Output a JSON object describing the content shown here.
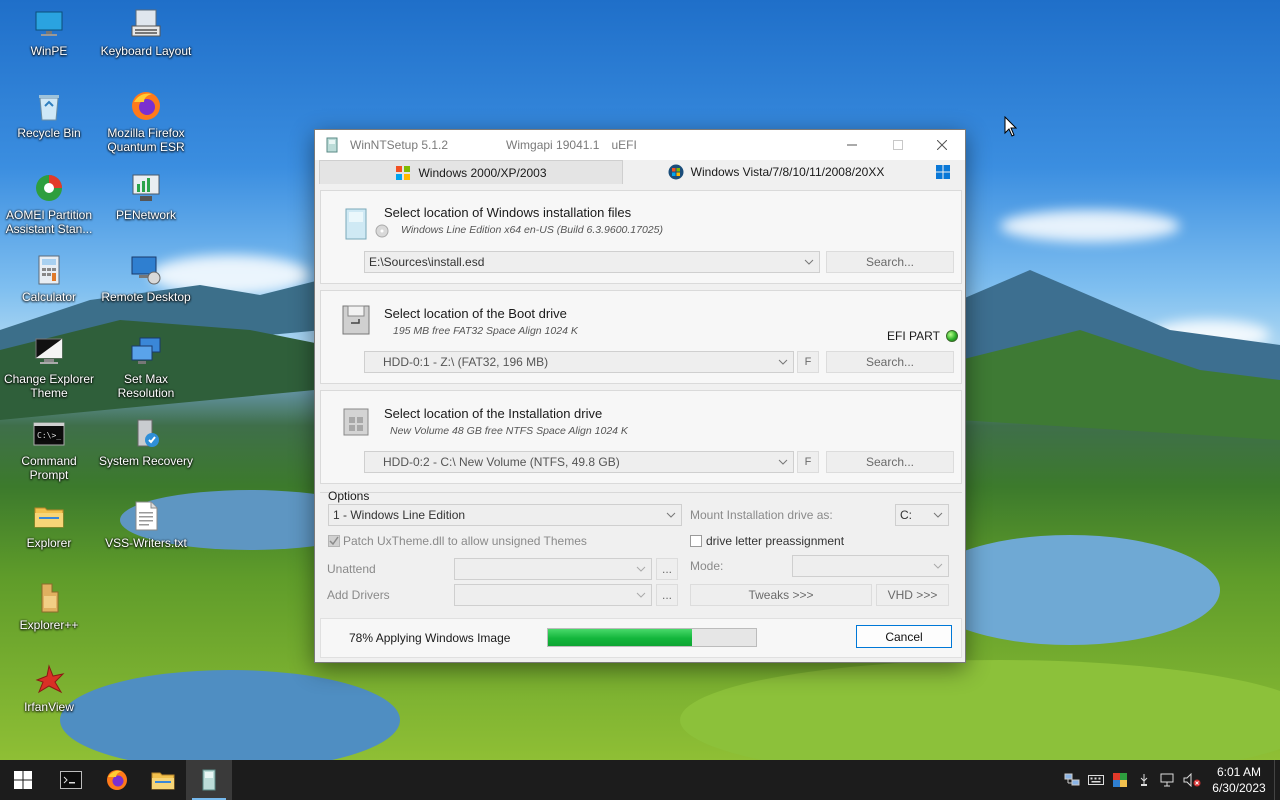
{
  "desktop": {
    "icons": [
      {
        "label": "WinPE",
        "icon": "monitor-icon"
      },
      {
        "label": "Keyboard Layout",
        "icon": "keyboard-icon"
      },
      {
        "label": "Recycle Bin",
        "icon": "recycle-bin-icon"
      },
      {
        "label": "Mozilla Firefox Quantum ESR",
        "icon": "firefox-icon"
      },
      {
        "label": "AOMEI Partition Assistant Stan...",
        "icon": "partition-icon"
      },
      {
        "label": "PENetwork",
        "icon": "network-icon"
      },
      {
        "label": "Calculator",
        "icon": "calculator-icon"
      },
      {
        "label": "Remote Desktop",
        "icon": "remote-desktop-icon"
      },
      {
        "label": "Change Explorer Theme",
        "icon": "theme-icon"
      },
      {
        "label": "Set Max Resolution",
        "icon": "resolution-icon"
      },
      {
        "label": "Command Prompt",
        "icon": "cmd-icon"
      },
      {
        "label": "System Recovery",
        "icon": "recovery-icon"
      },
      {
        "label": "Explorer",
        "icon": "folder-icon"
      },
      {
        "label": "VSS-Writers.txt",
        "icon": "text-file-icon"
      },
      {
        "label": "Explorer++",
        "icon": "explorerpp-icon"
      },
      {
        "label": "IrfanView",
        "icon": "irfanview-icon"
      }
    ]
  },
  "window": {
    "title": "WinNTSetup 5.1.2",
    "wimgapi": "Wimgapi 19041.1",
    "mode": "uEFI",
    "tabs": [
      "Windows 2000/XP/2003",
      "Windows Vista/7/8/10/11/2008/20XX"
    ],
    "install_files": {
      "title": "Select location of Windows installation files",
      "subtitle": "Windows Line Edition  x64 en-US (Build 6.3.9600.17025)",
      "path": "E:\\Sources\\install.esd",
      "search_label": "Search..."
    },
    "boot_drive": {
      "title": "Select location of the Boot drive",
      "subtitle": "195 MB free FAT32 Space Align 1024 K",
      "efi_label": "EFI PART",
      "value": "HDD-0:1 - Z:\\  (FAT32, 196 MB)",
      "f_label": "F",
      "search_label": "Search..."
    },
    "install_drive": {
      "title": "Select location of the Installation drive",
      "subtitle": "New Volume 48 GB free NTFS Space Align 1024 K",
      "value": "HDD-0:2 - C:\\ New Volume (NTFS, 49.8 GB)",
      "f_label": "F",
      "search_label": "Search..."
    },
    "options": {
      "heading": "Options",
      "edition": "1 - Windows Line Edition",
      "mount_label": "Mount Installation drive as:",
      "mount_value": "C:",
      "patch_label": "Patch UxTheme.dll to allow unsigned Themes",
      "drive_letter_label": "drive letter preassignment",
      "unattend_label": "Unattend",
      "add_drivers_label": "Add Drivers",
      "mode_label": "Mode:",
      "browse_label": "...",
      "tweaks_label": "Tweaks >>>",
      "vhd_label": "VHD >>>"
    },
    "status": {
      "text": "78% Applying Windows Image",
      "progress": 0.69,
      "cancel_label": "Cancel"
    }
  },
  "taskbar": {
    "time": "6:01 AM",
    "date": "6/30/2023"
  }
}
